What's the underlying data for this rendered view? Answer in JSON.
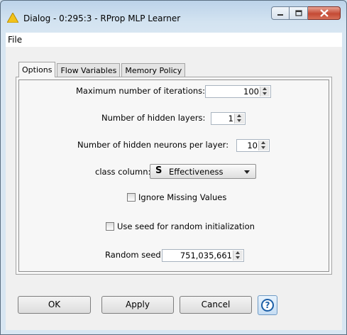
{
  "window": {
    "title": "Dialog - 0:295:3 - RProp MLP Learner",
    "controls": {
      "minimize": "minimize-icon",
      "maximize": "maximize-icon",
      "close": "close-icon"
    }
  },
  "menu": {
    "file": "File"
  },
  "tabs": [
    {
      "label": "Options",
      "active": true
    },
    {
      "label": "Flow Variables",
      "active": false
    },
    {
      "label": "Memory Policy",
      "active": false
    }
  ],
  "options": {
    "max_iterations": {
      "label": "Maximum number of iterations:",
      "value": "100"
    },
    "hidden_layers": {
      "label": "Number of hidden layers:",
      "value": "1"
    },
    "hidden_neurons": {
      "label": "Number of hidden neurons per layer:",
      "value": "10"
    },
    "class_column": {
      "label": "class column:",
      "icon_letter": "S",
      "value": "Effectiveness"
    },
    "ignore_missing": {
      "label": "Ignore Missing Values",
      "checked": false
    },
    "use_seed": {
      "label": "Use seed for random initialization",
      "checked": false
    },
    "random_seed": {
      "label": "Random seed",
      "value": "751,035,661"
    }
  },
  "buttons": {
    "ok": "OK",
    "apply": "Apply",
    "cancel": "Cancel",
    "help": "?"
  },
  "colors": {
    "close_button": "#c44a34",
    "help_accent": "#1b5ea6",
    "warning_icon": "#f2c21a"
  }
}
